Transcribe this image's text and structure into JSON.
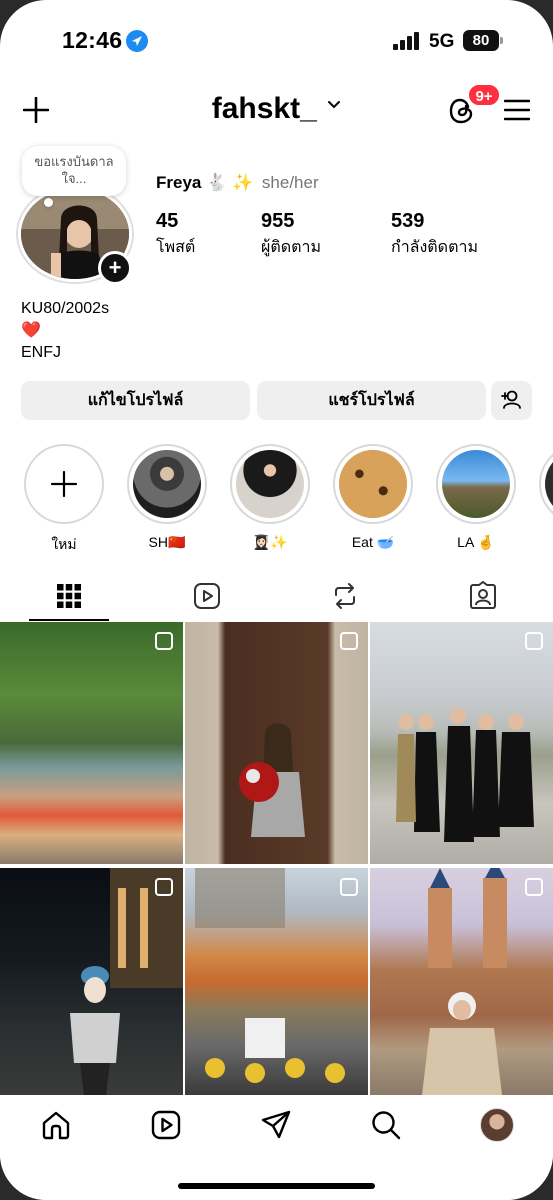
{
  "status_bar": {
    "time": "12:46",
    "network": "5G",
    "battery": "80"
  },
  "header": {
    "username": "fahskt_",
    "notification_badge": "9+"
  },
  "profile": {
    "note": "ขอแรงบันดาล\nใจ...",
    "name": "Freya",
    "name_emoji": "🐇 ✨",
    "pronouns": "she/her",
    "stats": [
      {
        "value": "45",
        "label": "โพสต์"
      },
      {
        "value": "955",
        "label": "ผู้ติดตาม"
      },
      {
        "value": "539",
        "label": "กำลังติดตาม"
      }
    ],
    "bio": [
      "KU80/2002s",
      "❤️",
      "ENFJ"
    ]
  },
  "buttons": {
    "edit_profile": "แก้ไขโปรไฟล์",
    "share_profile": "แชร์โปรไฟล์"
  },
  "highlights": [
    {
      "label": "ใหม่"
    },
    {
      "label": "SH🇨🇳"
    },
    {
      "label": "👩🏻‍🎓✨"
    },
    {
      "label": "Eat 🥣"
    },
    {
      "label": "LA 🤞"
    }
  ],
  "tabs": [
    "grid",
    "reels",
    "reposts",
    "tagged"
  ],
  "colors": {
    "badge": "#ff2f40",
    "location": "#1d8cf0"
  }
}
